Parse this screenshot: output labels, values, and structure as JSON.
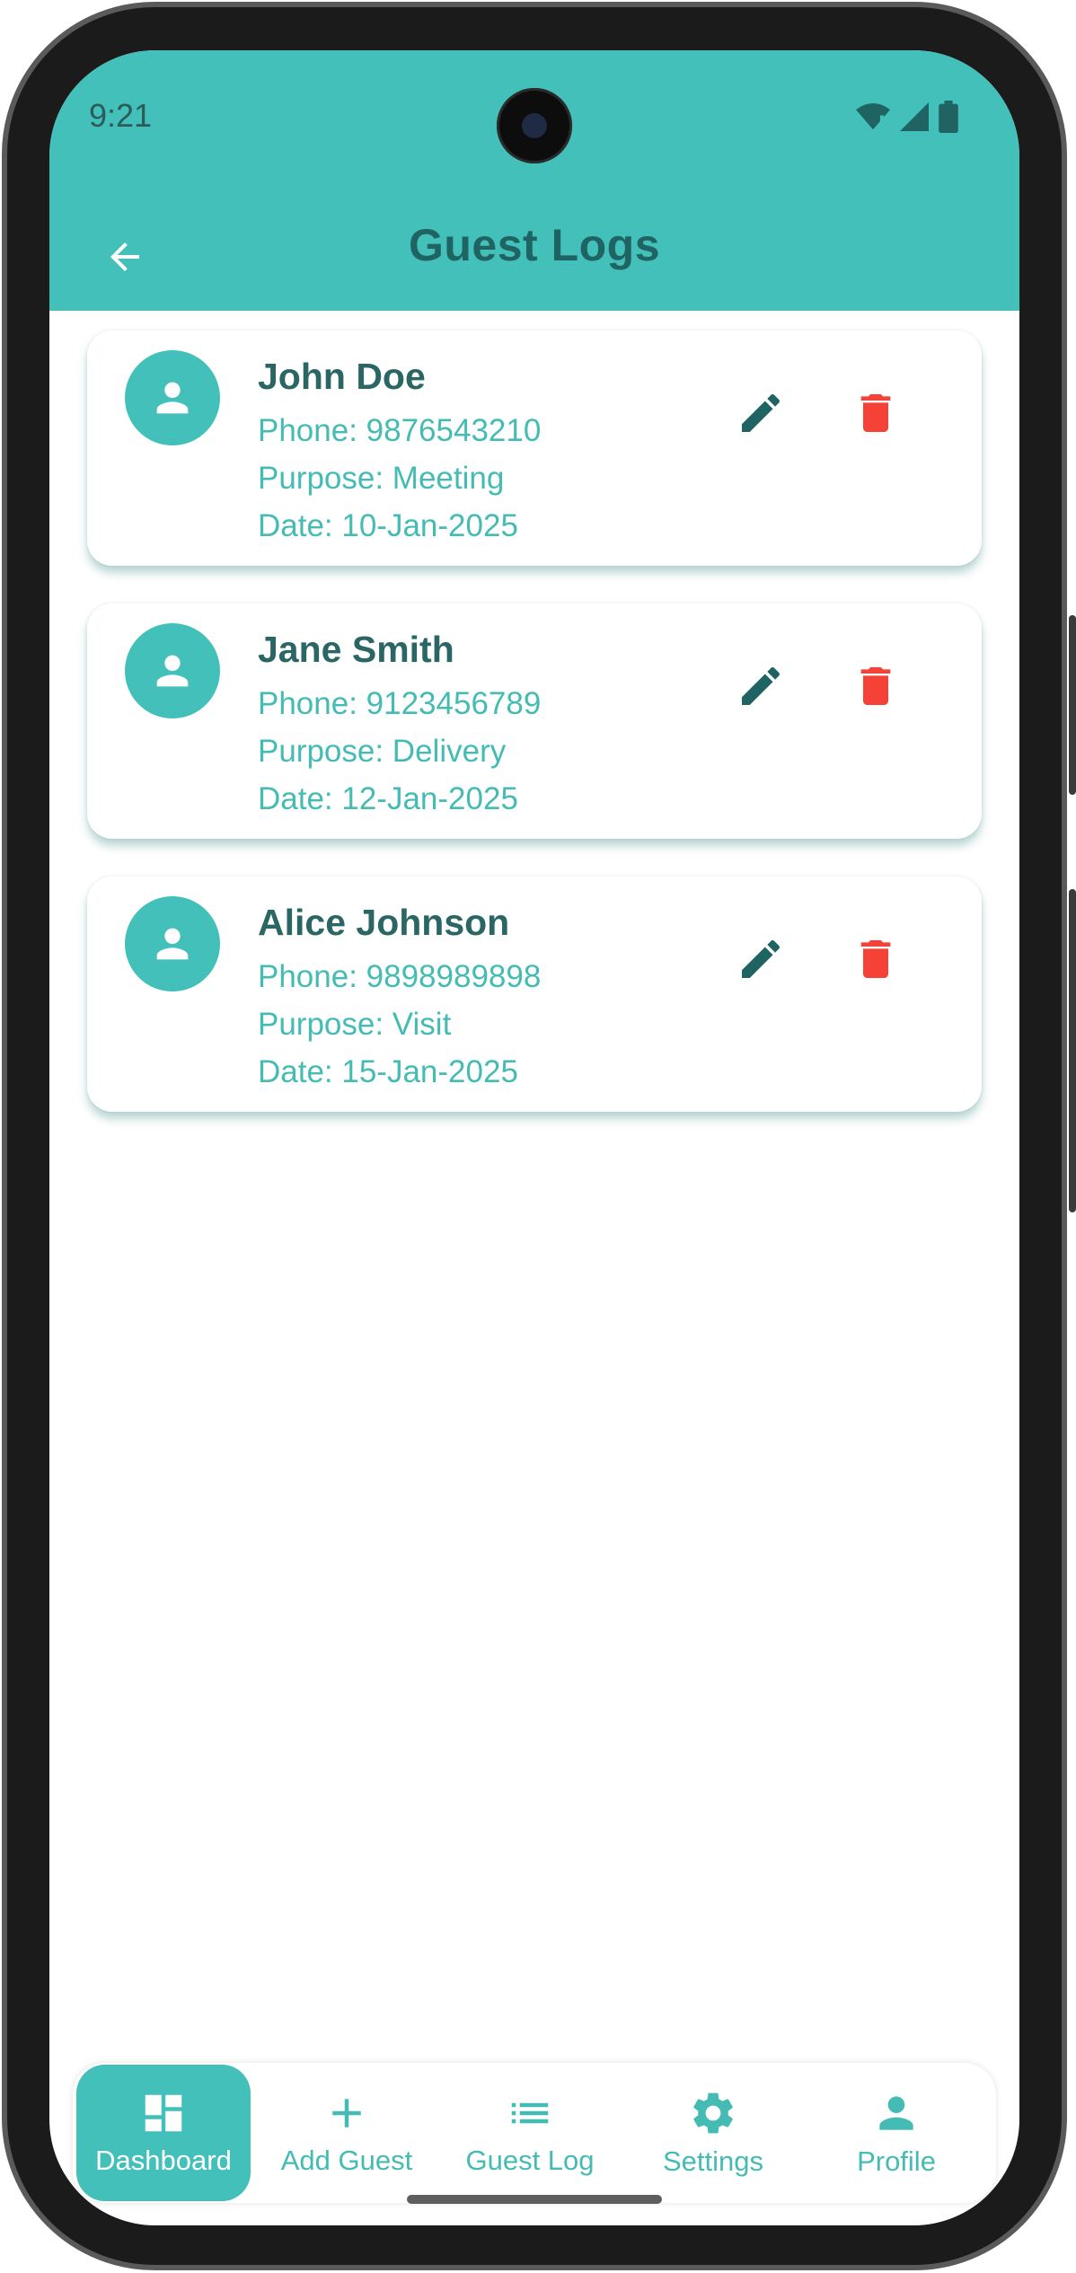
{
  "status_bar": {
    "time": "9:21"
  },
  "header": {
    "title": "Guest Logs"
  },
  "guests": [
    {
      "name": "John Doe",
      "phone": "Phone: 9876543210",
      "purpose": "Purpose: Meeting",
      "date": "Date: 10-Jan-2025"
    },
    {
      "name": "Jane Smith",
      "phone": "Phone: 9123456789",
      "purpose": "Purpose: Delivery",
      "date": "Date: 12-Jan-2025"
    },
    {
      "name": "Alice Johnson",
      "phone": "Phone: 9898989898",
      "purpose": "Purpose: Visit",
      "date": "Date: 15-Jan-2025"
    }
  ],
  "bottom_nav": {
    "items": [
      {
        "label": "Dashboard",
        "icon": "dashboard-icon",
        "active": true
      },
      {
        "label": "Add Guest",
        "icon": "plus-icon",
        "active": false
      },
      {
        "label": "Guest Log",
        "icon": "list-icon",
        "active": false
      },
      {
        "label": "Settings",
        "icon": "gear-icon",
        "active": false
      },
      {
        "label": "Profile",
        "icon": "person-icon",
        "active": false
      }
    ]
  },
  "colors": {
    "primary": "#42c0b9",
    "dark_teal": "#1f6463",
    "delete_red": "#f44336",
    "text_teal": "#45bcb3"
  }
}
